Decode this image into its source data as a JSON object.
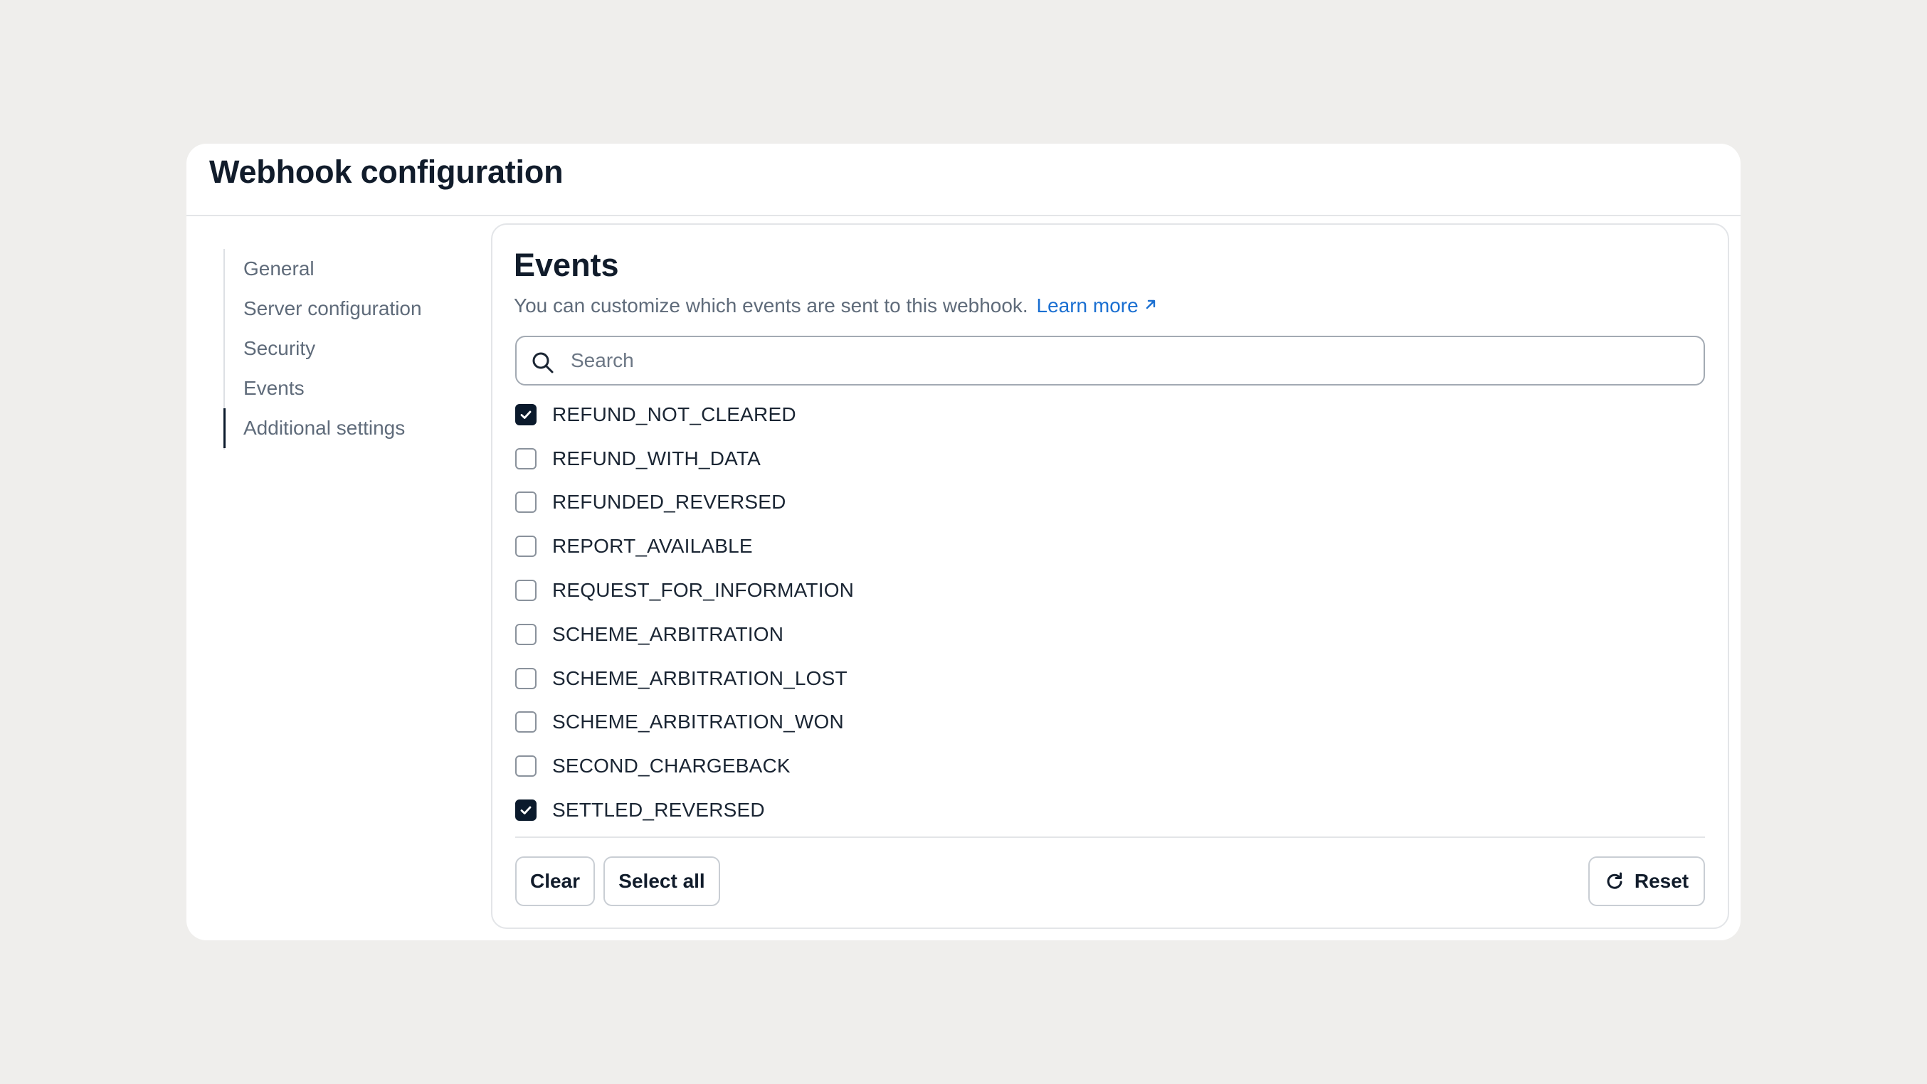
{
  "card": {
    "title": "Webhook configuration"
  },
  "sidenav": {
    "items": [
      {
        "label": "General",
        "active": false
      },
      {
        "label": "Server configuration",
        "active": false
      },
      {
        "label": "Security",
        "active": false
      },
      {
        "label": "Events",
        "active": false
      },
      {
        "label": "Additional settings",
        "active": true
      }
    ]
  },
  "events": {
    "title": "Events",
    "description": "You can customize which events are sent to this webhook.",
    "learn_more": "Learn more",
    "learn_more_icon": "external-link-icon",
    "search": {
      "placeholder": "Search",
      "value": ""
    },
    "items": [
      {
        "label": "REFUND_NOT_CLEARED",
        "checked": true
      },
      {
        "label": "REFUND_WITH_DATA",
        "checked": false
      },
      {
        "label": "REFUNDED_REVERSED",
        "checked": false
      },
      {
        "label": "REPORT_AVAILABLE",
        "checked": false
      },
      {
        "label": "REQUEST_FOR_INFORMATION",
        "checked": false
      },
      {
        "label": "SCHEME_ARBITRATION",
        "checked": false
      },
      {
        "label": "SCHEME_ARBITRATION_LOST",
        "checked": false
      },
      {
        "label": "SCHEME_ARBITRATION_WON",
        "checked": false
      },
      {
        "label": "SECOND_CHARGEBACK",
        "checked": false
      },
      {
        "label": "SETTLED_REVERSED",
        "checked": true
      }
    ]
  },
  "actions": {
    "clear_label": "Clear",
    "select_all_label": "Select all",
    "reset_label": "Reset",
    "reset_icon": "refresh-icon"
  },
  "colors": {
    "background": "#efeeec",
    "accent_link": "#1a6fd1",
    "checked_fill": "#0b1a2c"
  }
}
